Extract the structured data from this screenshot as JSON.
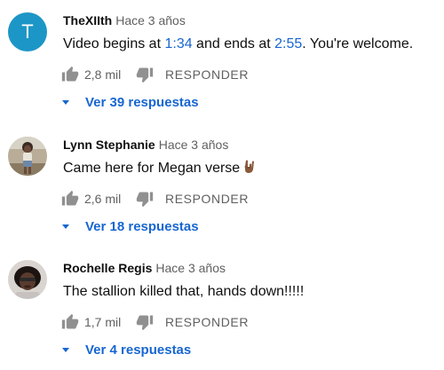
{
  "comments": [
    {
      "avatar_letter": "T",
      "author": "TheXIIth",
      "time": "Hace 3 años",
      "text_parts": {
        "p1": "Video begins at ",
        "link1": "1:34",
        "p2": " and ends at ",
        "link2": "2:55",
        "p3": ". You're welcome."
      },
      "likes": "2,8 mil",
      "reply_label": "RESPONDER",
      "replies_label": "Ver 39 respuestas"
    },
    {
      "author": "Lynn Stephanie",
      "time": "Hace 3 años",
      "text": "Came here for Megan verse",
      "emoji_icon": "rock-on-hand-emoji",
      "likes": "2,6 mil",
      "reply_label": "RESPONDER",
      "replies_label": "Ver 18 respuestas"
    },
    {
      "author": "Rochelle Regis",
      "time": "Hace 3 años",
      "text": "The stallion killed that, hands down!!!!!",
      "likes": "1,7 mil",
      "reply_label": "RESPONDER",
      "replies_label": "Ver 4 respuestas"
    }
  ],
  "colors": {
    "link": "#1766d1",
    "secondary_text": "#606060",
    "avatar_t_bg": "#1c96c6",
    "icon": "#909090"
  },
  "icons": {
    "like": "thumbs-up-icon",
    "dislike": "thumbs-down-icon",
    "expand": "caret-down-icon"
  }
}
